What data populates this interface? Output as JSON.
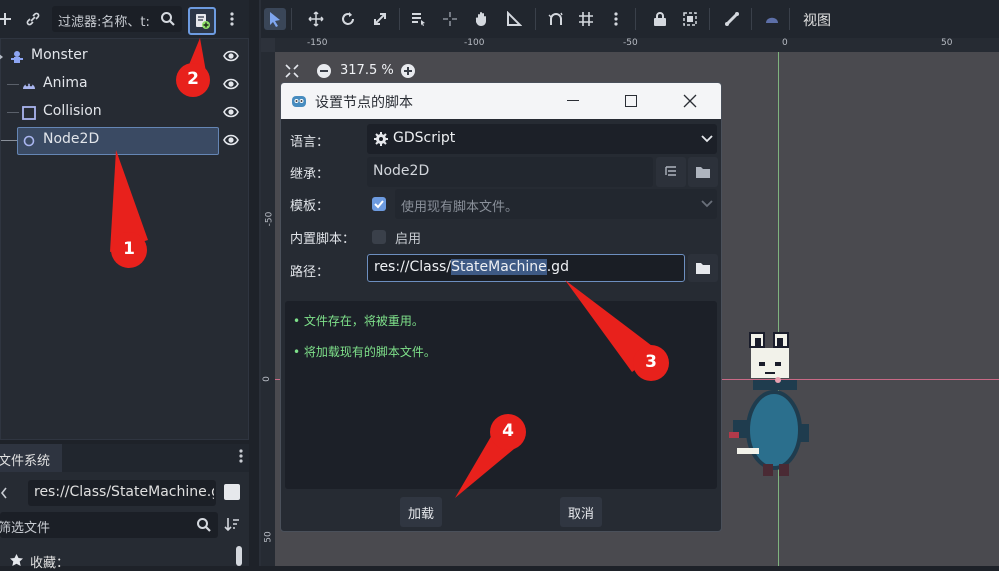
{
  "scene_dock": {
    "filter_placeholder": "过滤器:名称、t:",
    "nodes": [
      {
        "name": "Monster",
        "icon": "monster-icon"
      },
      {
        "name": "Anima",
        "icon": "animation-icon"
      },
      {
        "name": "Collision",
        "icon": "collision-icon"
      },
      {
        "name": "Node2D",
        "icon": "node2d-icon"
      }
    ]
  },
  "filesystem_dock": {
    "tab_label": "文件系统",
    "path": "res://Class/StateMachine.g",
    "filter_placeholder": "筛选文件",
    "favorites_label": "收藏："
  },
  "editor_toolbar": {
    "view_menu": "视图"
  },
  "viewport": {
    "zoom": "317.5 %",
    "ruler_top": [
      "-150",
      "-100",
      "-50",
      "0",
      "50"
    ],
    "ruler_left": [
      "-50",
      "0",
      "50"
    ]
  },
  "dialog": {
    "title": "设置节点的脚本",
    "language_label": "语言：",
    "language_value": "GDScript",
    "inherits_label": "继承：",
    "inherits_value": "Node2D",
    "template_label": "模板：",
    "template_value": "使用现有脚本文件。",
    "builtin_label": "内置脚本：",
    "builtin_value": "启用",
    "path_label": "路径：",
    "path_prefix": "res://Class/",
    "path_selected": "StateMachine",
    "path_suffix": ".gd",
    "messages": [
      "• 文件存在，将被重用。",
      "• 将加载现有的脚本文件。"
    ],
    "load_button": "加载",
    "cancel_button": "取消"
  },
  "annotations": [
    "1",
    "2",
    "3",
    "4"
  ],
  "colors": {
    "accent": "#6d8fc0",
    "message_green": "#7ee08a",
    "annotation_red": "#e8211c"
  }
}
